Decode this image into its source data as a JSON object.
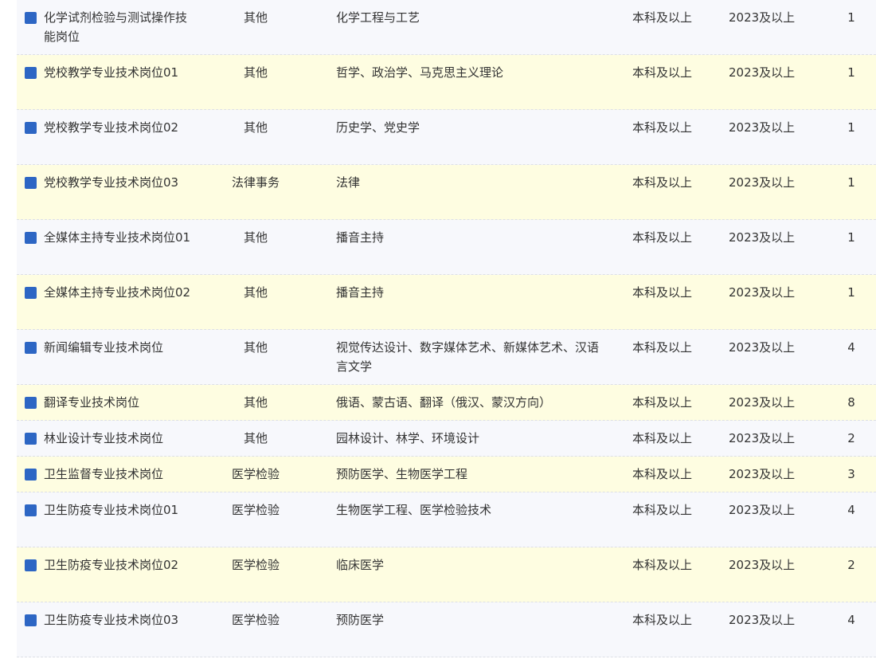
{
  "colors": {
    "row_odd": "#f7f8fc",
    "row_even": "#fefde1",
    "marker": "#2d66c4"
  },
  "rows": [
    {
      "name": "化学试剂检验与测试操作技能岗位",
      "category": "其他",
      "major": "化学工程与工艺",
      "education": "本科及以上",
      "year": "2023及以上",
      "count": "1"
    },
    {
      "name": "党校教学专业技术岗位01",
      "category": "其他",
      "major": "哲学、政治学、马克思主义理论",
      "education": "本科及以上",
      "year": "2023及以上",
      "count": "1"
    },
    {
      "name": "党校教学专业技术岗位02",
      "category": "其他",
      "major": "历史学、党史学",
      "education": "本科及以上",
      "year": "2023及以上",
      "count": "1"
    },
    {
      "name": "党校教学专业技术岗位03",
      "category": "法律事务",
      "major": "法律",
      "education": "本科及以上",
      "year": "2023及以上",
      "count": "1"
    },
    {
      "name": "全媒体主持专业技术岗位01",
      "category": "其他",
      "major": "播音主持",
      "education": "本科及以上",
      "year": "2023及以上",
      "count": "1"
    },
    {
      "name": "全媒体主持专业技术岗位02",
      "category": "其他",
      "major": "播音主持",
      "education": "本科及以上",
      "year": "2023及以上",
      "count": "1"
    },
    {
      "name": "新闻编辑专业技术岗位",
      "category": "其他",
      "major": "视觉传达设计、数字媒体艺术、新媒体艺术、汉语言文学",
      "education": "本科及以上",
      "year": "2023及以上",
      "count": "4"
    },
    {
      "name": "翻译专业技术岗位",
      "category": "其他",
      "major": "俄语、蒙古语、翻译（俄汉、蒙汉方向）",
      "education": "本科及以上",
      "year": "2023及以上",
      "count": "8"
    },
    {
      "name": "林业设计专业技术岗位",
      "category": "其他",
      "major": "园林设计、林学、环境设计",
      "education": "本科及以上",
      "year": "2023及以上",
      "count": "2"
    },
    {
      "name": "卫生监督专业技术岗位",
      "category": "医学检验",
      "major": "预防医学、生物医学工程",
      "education": "本科及以上",
      "year": "2023及以上",
      "count": "3"
    },
    {
      "name": "卫生防疫专业技术岗位01",
      "category": "医学检验",
      "major": "生物医学工程、医学检验技术",
      "education": "本科及以上",
      "year": "2023及以上",
      "count": "4"
    },
    {
      "name": "卫生防疫专业技术岗位02",
      "category": "医学检验",
      "major": "临床医学",
      "education": "本科及以上",
      "year": "2023及以上",
      "count": "2"
    },
    {
      "name": "卫生防疫专业技术岗位03",
      "category": "医学检验",
      "major": "预防医学",
      "education": "本科及以上",
      "year": "2023及以上",
      "count": "4"
    }
  ]
}
